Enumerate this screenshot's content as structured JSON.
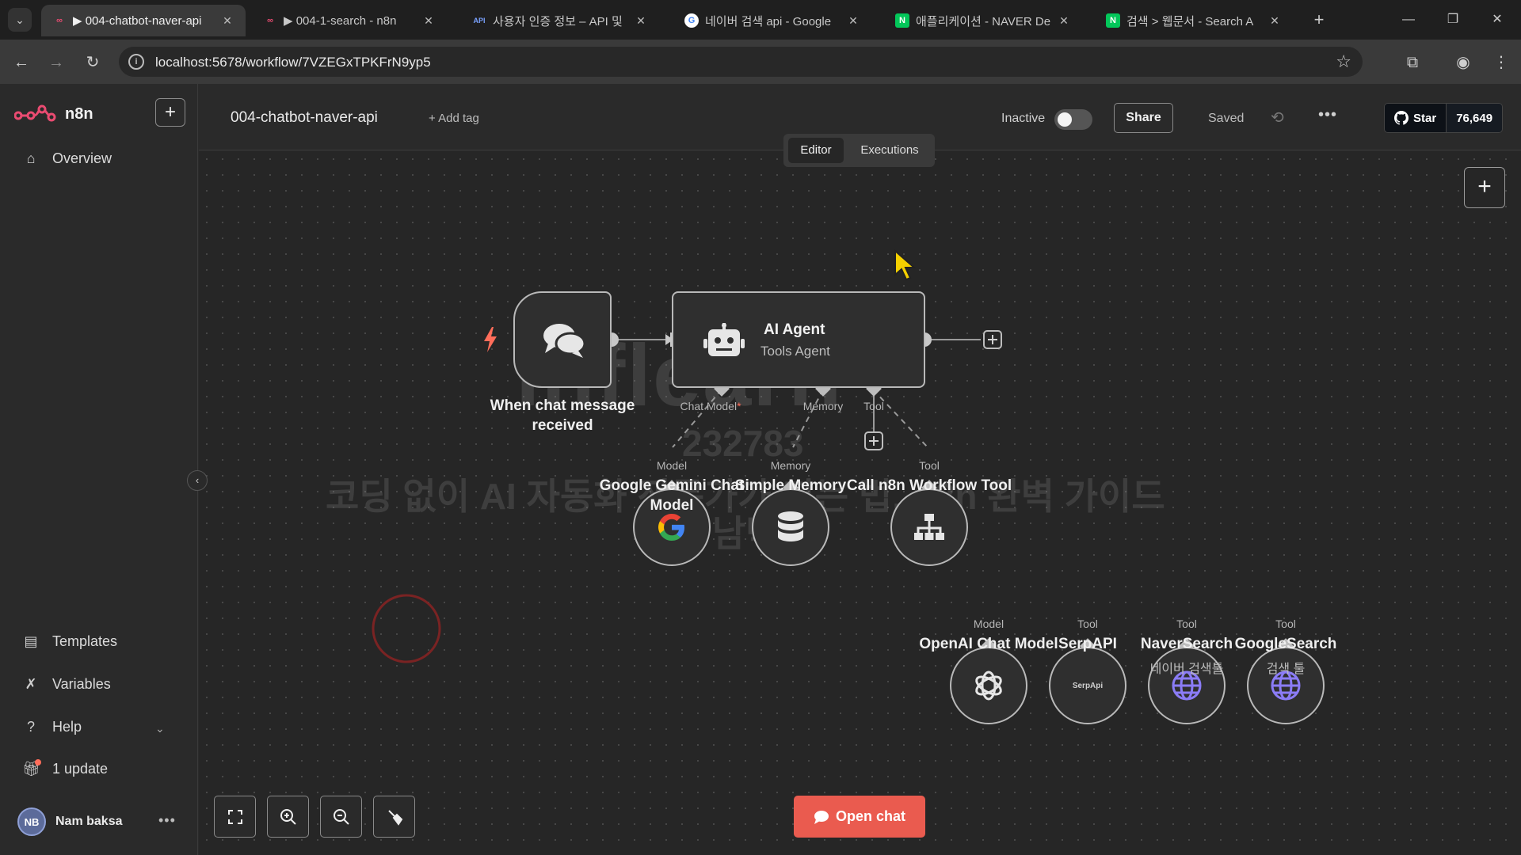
{
  "browser": {
    "tabs": [
      {
        "title": "▶ 004-chatbot-naver-api",
        "icon": "n8n-logo-icon",
        "active": true
      },
      {
        "title": "▶ 004-1-search - n8n",
        "icon": "n8n-logo-icon",
        "active": false
      },
      {
        "title": "사용자 인증 정보 – API 및",
        "icon": "api-icon",
        "active": false
      },
      {
        "title": "네이버 검색 api - Google",
        "icon": "google-icon",
        "active": false
      },
      {
        "title": "애플리케이션 - NAVER De",
        "icon": "naver-icon",
        "active": false
      },
      {
        "title": "검색 > 웹문서 - Search A",
        "icon": "naver-icon",
        "active": false
      }
    ],
    "url": "localhost:5678/workflow/7VZEGxTPKFrN9yp5"
  },
  "sidebar": {
    "app_name": "n8n",
    "items_top": [
      {
        "label": "Overview",
        "icon": "home-icon"
      }
    ],
    "items_bottom": [
      {
        "label": "Templates",
        "icon": "templates-icon"
      },
      {
        "label": "Variables",
        "icon": "variables-icon"
      },
      {
        "label": "Help",
        "icon": "help-icon"
      },
      {
        "label": "1 update",
        "icon": "gift-icon"
      }
    ],
    "user": {
      "initials": "NB",
      "name": "Nam baksa"
    }
  },
  "header": {
    "workflow_name": "004-chatbot-naver-api",
    "add_tag": "+ Add tag",
    "status_label": "Inactive",
    "active": false,
    "share_label": "Share",
    "saved_label": "Saved",
    "github": {
      "star_label": "Star",
      "count": "76,649"
    },
    "modes": [
      "Editor",
      "Executions"
    ],
    "selected_mode": "Editor"
  },
  "canvas": {
    "nodes": {
      "trigger": {
        "label": "When chat message received",
        "icon": "chat-bubbles-icon"
      },
      "agent": {
        "title": "AI Agent",
        "subtitle": "Tools Agent",
        "icon": "robot-icon"
      },
      "gemini": {
        "label": "Google Gemini Chat Model",
        "icon": "google-icon"
      },
      "memory": {
        "label": "Simple Memory",
        "icon": "database-icon"
      },
      "workflow_tool": {
        "label": "Call n8n Workflow Tool",
        "icon": "sitemap-icon"
      },
      "openai": {
        "label": "OpenAI Chat Model",
        "icon": "openai-icon"
      },
      "serpapi": {
        "label": "SerpAPI",
        "icon_text": "SerpApi"
      },
      "naver": {
        "label": "NaverSearch",
        "sublabel": "네이버 검색툴",
        "icon": "globe-icon"
      },
      "google": {
        "label": "GoogleSearch",
        "sublabel": "검색 툴",
        "icon": "globe-icon"
      }
    },
    "ports": {
      "agent_chat_model": "Chat Model",
      "agent_required_mark": "*",
      "agent_memory": "Memory",
      "agent_tool": "Tool",
      "gemini_model": "Model",
      "memory_memory": "Memory",
      "workflow_tool": "Tool",
      "openai_model": "Model",
      "serpapi_tool": "Tool",
      "naver_tool": "Tool",
      "google_tool": "Tool"
    },
    "watermark": {
      "brand": "inflearn",
      "id": "232783",
      "course_line1": "코딩 없이 AI 자동화 전문가가 되는 법, n8n 완벽 가이드",
      "course_line2": "남박사"
    },
    "open_chat_label": "Open chat"
  },
  "colors": {
    "accent": "#ea5b4f",
    "trigger_bolt": "#ff6d5a",
    "logo": "#ea4b71"
  }
}
